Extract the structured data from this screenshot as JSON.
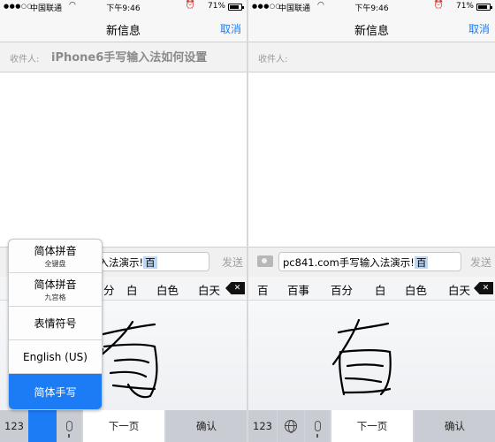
{
  "status": {
    "signal": "●●●○○",
    "carrier": "中国联通",
    "wifi_icon": "wifi-icon",
    "time": "下午9:46",
    "alarm_icon": "alarm-icon",
    "battery_percent": "71%",
    "battery_level": 0.71
  },
  "nav": {
    "title": "新信息",
    "cancel_label": "取消"
  },
  "recipient": {
    "label": "收件人:"
  },
  "overlay_caption": "iPhone6手写输入法如何设置",
  "left": {
    "input_text": "手写输入法演示!",
    "input_composing": "百",
    "send_label": "发送",
    "candidates": [
      "分",
      "白",
      "白色",
      "白天"
    ],
    "language_menu": [
      {
        "label": "简体拼音",
        "sub": "全键盘"
      },
      {
        "label": "简体拼音",
        "sub": "九宫格"
      },
      {
        "label": "表情符号",
        "sub": ""
      },
      {
        "label": "English (US)",
        "sub": ""
      },
      {
        "label": "简体手写",
        "sub": ""
      }
    ],
    "bottom": {
      "key_123": "123",
      "next_page": "下一页",
      "confirm": "确认"
    }
  },
  "right": {
    "input_text": "pc841.com手写输入法演示!",
    "input_composing": "百",
    "send_label": "发送",
    "candidates": [
      "百",
      "百事",
      "百分",
      "白",
      "白色",
      "白天"
    ],
    "bottom": {
      "key_123": "123",
      "next_page": "下一页",
      "confirm": "确认"
    }
  },
  "colors": {
    "accent": "#1b7cf6",
    "selection": "#bcd6f5"
  }
}
